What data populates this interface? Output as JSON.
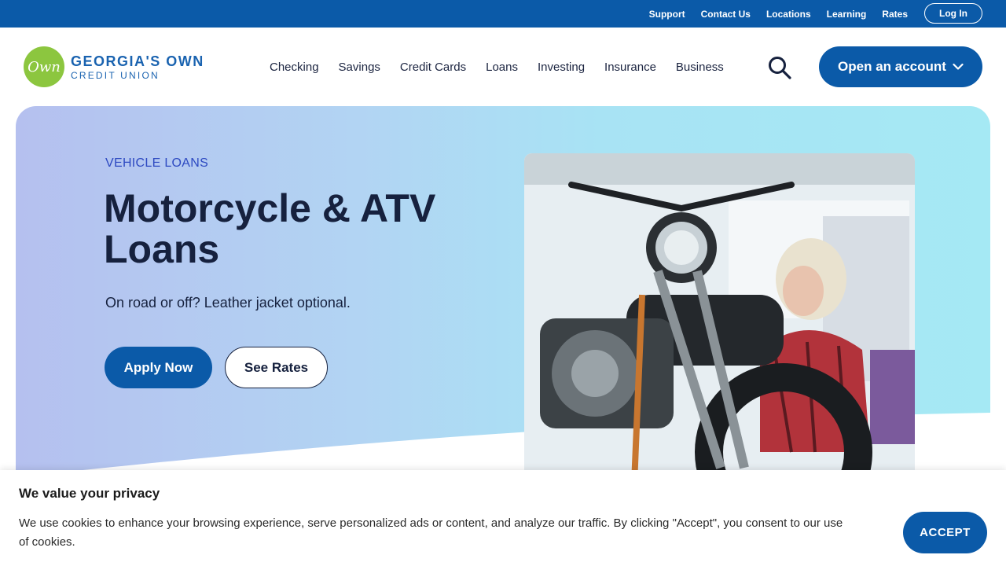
{
  "utility_nav": {
    "links": [
      "Support",
      "Contact Us",
      "Locations",
      "Learning",
      "Rates"
    ],
    "login_label": "Log In"
  },
  "brand": {
    "logo_mark": "Own",
    "name_line1": "GEORGIA'S OWN",
    "name_line2": "CREDIT UNION",
    "colors": {
      "primary": "#0b5aa8",
      "logo_green": "#8cc63f",
      "dark_text": "#16213e"
    }
  },
  "main_nav": {
    "items": [
      "Checking",
      "Savings",
      "Credit Cards",
      "Loans",
      "Investing",
      "Insurance",
      "Business"
    ],
    "search_icon": "search-icon",
    "cta_label": "Open an account",
    "cta_icon": "chevron-down-icon"
  },
  "hero": {
    "eyebrow": "VEHICLE LOANS",
    "title": "Motorcycle & ATV Loans",
    "subtitle": "On road or off? Leather jacket optional.",
    "primary_button": "Apply Now",
    "secondary_button": "See Rates"
  },
  "cookie_banner": {
    "title": "We value your privacy",
    "body": "We use cookies to enhance your browsing experience, serve personalized ads or content, and analyze our traffic. By clicking \"Accept\", you consent to our use of cookies.",
    "accept_label": "ACCEPT"
  }
}
